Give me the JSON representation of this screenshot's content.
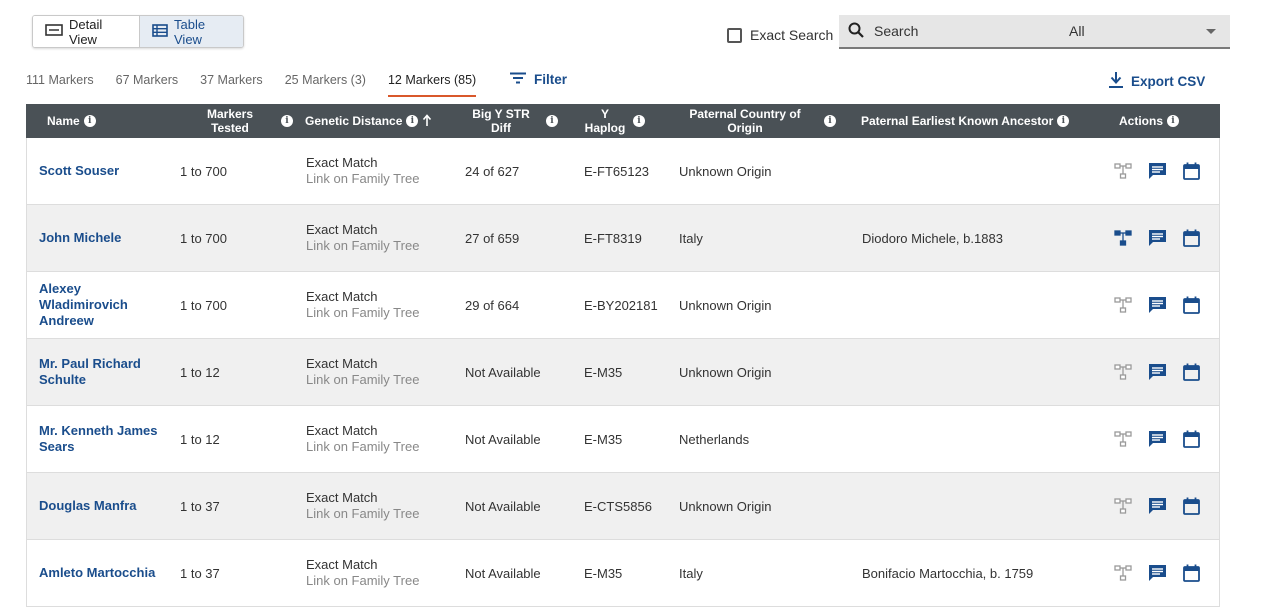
{
  "toolbar": {
    "detail_view": "Detail View",
    "table_view": "Table View",
    "exact_search": "Exact Search",
    "search_placeholder": "Search",
    "search_scope": "All",
    "filter": "Filter",
    "export": "Export CSV"
  },
  "tabs": [
    {
      "label": "111 Markers",
      "active": false
    },
    {
      "label": "67 Markers",
      "active": false
    },
    {
      "label": "37 Markers",
      "active": false
    },
    {
      "label": "25 Markers (3)",
      "active": false
    },
    {
      "label": "12 Markers (85)",
      "active": true
    }
  ],
  "columns": {
    "name": "Name",
    "markers_1": "Markers",
    "markers_2": "Tested",
    "gd": "Genetic Distance",
    "bigy_1": "Big Y STR",
    "bigy_2": "Diff",
    "hap_1": "Y",
    "hap_2": "Haplog",
    "country_1": "Paternal Country of",
    "country_2": "Origin",
    "anc": "Paternal Earliest Known Ancestor",
    "actions": "Actions"
  },
  "colors": {
    "accent": "#1a4d8c",
    "header_bg": "#4a5156",
    "active_tab_underline": "#d9582b"
  },
  "rows": [
    {
      "name": "Scott Souser",
      "markers": "1 to 700",
      "gd": "Exact Match",
      "gd_link": "Link on Family Tree",
      "bigy": "24 of 627",
      "hap": "E-FT65123",
      "country": "Unknown Origin",
      "ancestor": "",
      "tree_linked": false
    },
    {
      "name": "John Michele",
      "markers": "1 to 700",
      "gd": "Exact Match",
      "gd_link": "Link on Family Tree",
      "bigy": "27 of 659",
      "hap": "E-FT8319",
      "country": "Italy",
      "ancestor": "Diodoro Michele, b.1883",
      "tree_linked": true
    },
    {
      "name": "Alexey Wladimirovich Andreew",
      "markers": "1 to 700",
      "gd": "Exact Match",
      "gd_link": "Link on Family Tree",
      "bigy": "29 of 664",
      "hap": "E-BY202181",
      "country": "Unknown Origin",
      "ancestor": "",
      "tree_linked": false
    },
    {
      "name": "Mr. Paul Richard Schulte",
      "markers": "1 to 12",
      "gd": "Exact Match",
      "gd_link": "Link on Family Tree",
      "bigy": "Not Available",
      "hap": "E-M35",
      "country": "Unknown Origin",
      "ancestor": "",
      "tree_linked": false
    },
    {
      "name": "Mr. Kenneth James Sears",
      "markers": "1 to 12",
      "gd": "Exact Match",
      "gd_link": "Link on Family Tree",
      "bigy": "Not Available",
      "hap": "E-M35",
      "country": "Netherlands",
      "ancestor": "",
      "tree_linked": false
    },
    {
      "name": "Douglas Manfra",
      "markers": "1 to 37",
      "gd": "Exact Match",
      "gd_link": "Link on Family Tree",
      "bigy": "Not Available",
      "hap": "E-CTS5856",
      "country": "Unknown Origin",
      "ancestor": "",
      "tree_linked": false
    },
    {
      "name": "Amleto Martocchia",
      "markers": "1 to 37",
      "gd": "Exact Match",
      "gd_link": "Link on Family Tree",
      "bigy": "Not Available",
      "hap": "E-M35",
      "country": "Italy",
      "ancestor": "Bonifacio Martocchia, b. 1759",
      "tree_linked": false
    }
  ]
}
